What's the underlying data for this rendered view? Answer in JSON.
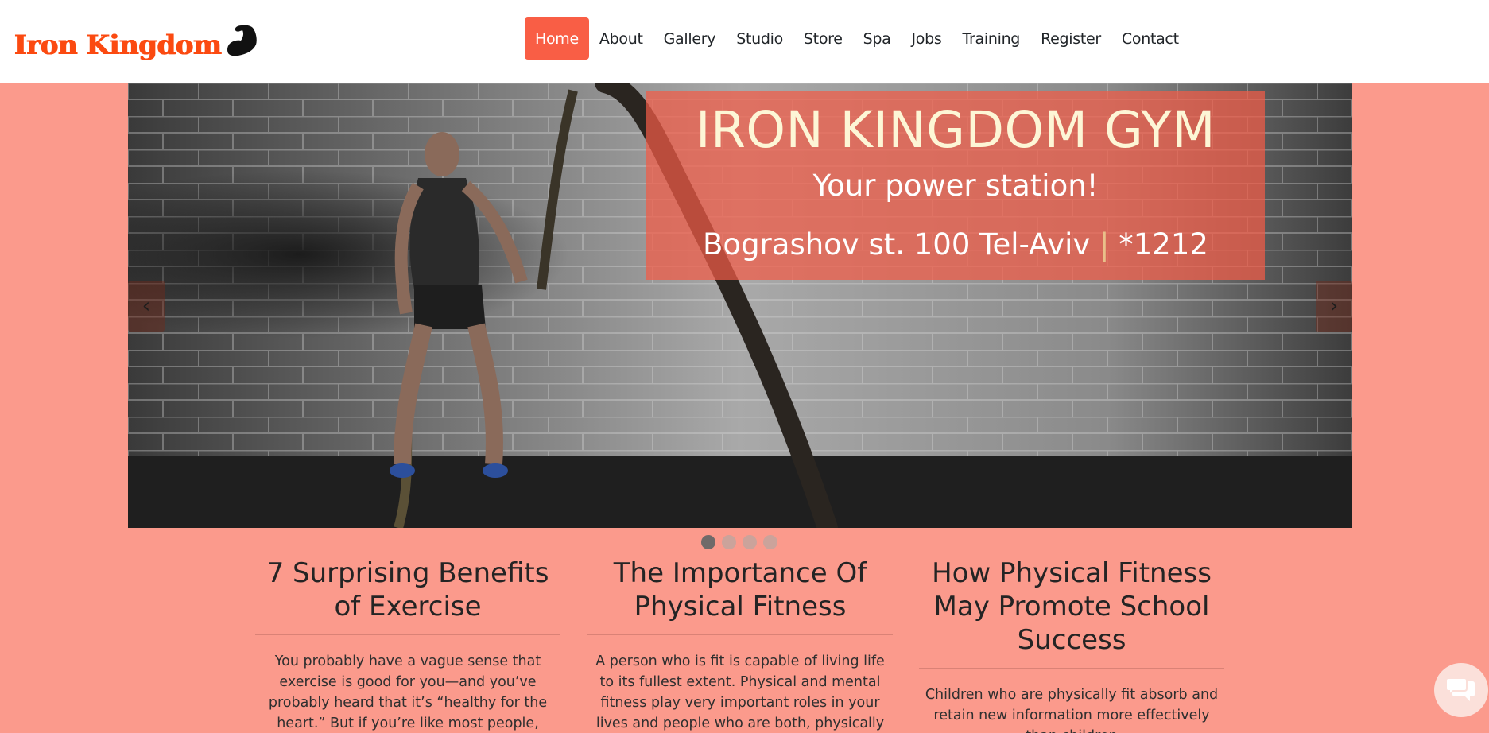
{
  "brand": {
    "name": "Iron Kingdom",
    "logo_icon": "flexed-biceps-icon",
    "color": "#fb4a11"
  },
  "nav": {
    "items": [
      {
        "label": "Home",
        "active": true
      },
      {
        "label": "About"
      },
      {
        "label": "Gallery"
      },
      {
        "label": "Studio"
      },
      {
        "label": "Store"
      },
      {
        "label": "Spa"
      },
      {
        "label": "Jobs"
      },
      {
        "label": "Training"
      },
      {
        "label": "Register"
      },
      {
        "label": "Contact"
      }
    ],
    "active_color": "#f95e45"
  },
  "hero": {
    "title": "IRON KINGDOM GYM",
    "subtitle": "Your power station!",
    "address": "Bograshov st. 100 Tel-Aviv",
    "separator": "|",
    "phone": "*1212",
    "prev_label": "‹",
    "next_label": "›",
    "slide_count": 4,
    "active_slide": 1
  },
  "articles": [
    {
      "title": "7 Surprising Benefits of Exercise",
      "text": "You probably have a vague sense that exercise is good for you—and you’ve probably heard that it’s “healthy for the heart.” But if you’re like most people, that’s not enough motivation to get you"
    },
    {
      "title": "The Importance Of Physical Fitness",
      "text": "A person who is fit is capable of living life to its fullest extent. Physical and mental fitness play very important roles in your lives and people who are both, physically and mentally fit are less"
    },
    {
      "title": "How Physical Fitness May Promote School Success",
      "text": "Children who are physically fit absorb and retain new information more effectively than children"
    }
  ],
  "chat": {
    "icon": "chat-bubbles-icon"
  },
  "colors": {
    "page_bg": "#fb9a8c",
    "caption_bg": "#f35c46",
    "header_bg": "#ffffff"
  }
}
